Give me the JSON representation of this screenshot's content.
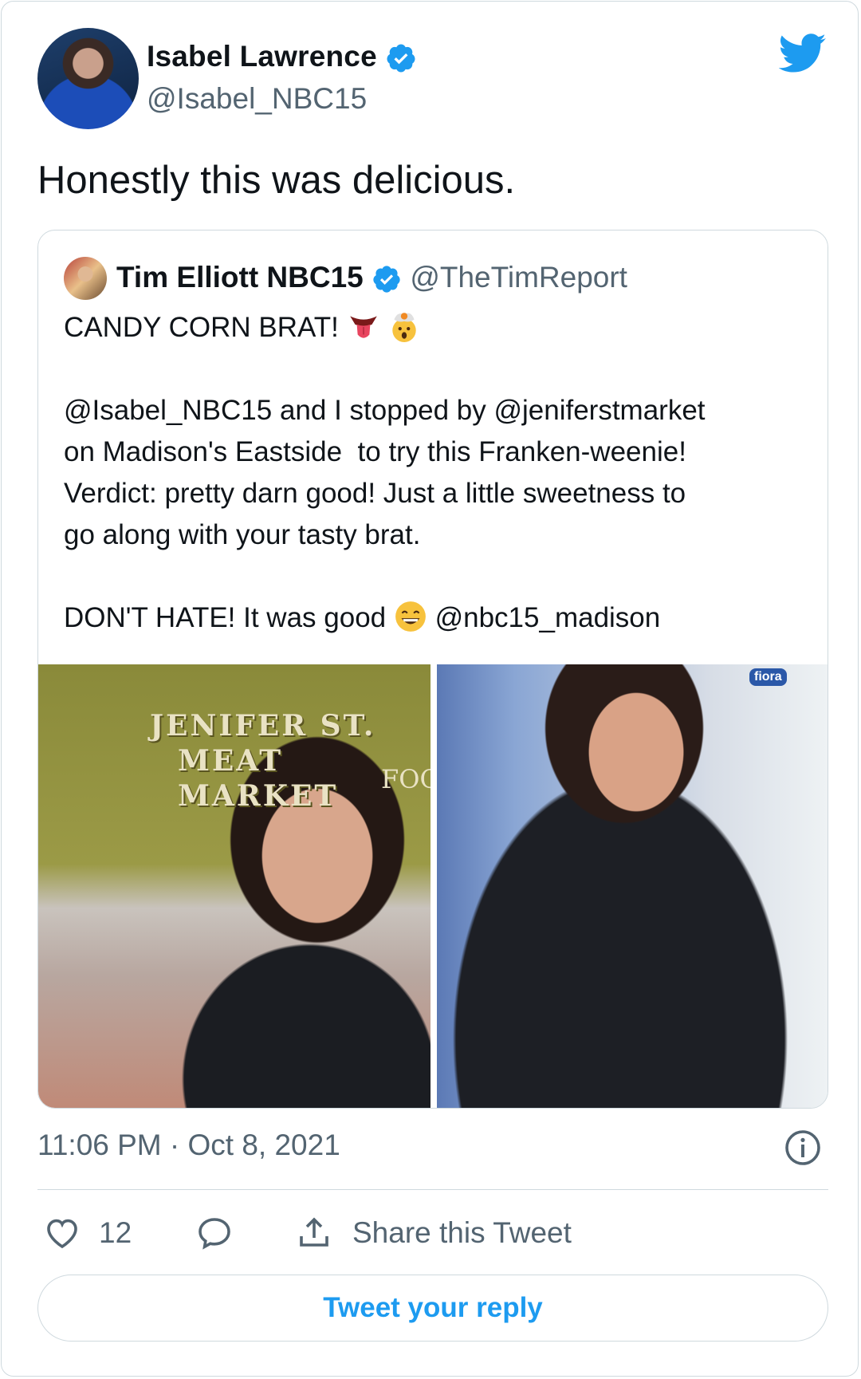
{
  "author": {
    "name": "Isabel Lawrence",
    "handle": "@Isabel_NBC15",
    "verified": true
  },
  "tweet": {
    "text": "Honestly this was delicious."
  },
  "quoted_tweet": {
    "author_name": "Tim Elliott NBC15",
    "author_handle": "@TheTimReport",
    "verified": true,
    "line1": "CANDY CORN BRAT!",
    "paragraph2": "@Isabel_NBC15 and I stopped by @jeniferstmarket\non Madison's Eastside  to try this Franken-weenie!\nVerdict: pretty darn good! Just a little sweetness to\ngo along with your tasty brat.",
    "line3_prefix": "DON'T HATE! It was good",
    "line3_suffix": "@nbc15_madison",
    "photo_sign_line1": "JENIFER ST.",
    "photo_sign_line2": "MEAT MARKET",
    "photo_sign_line3": "FOO",
    "photo_store_logo": "fiora"
  },
  "meta": {
    "timestamp": "11:06 PM · Oct 8, 2021"
  },
  "actions": {
    "like_count": "12",
    "share_label": "Share this Tweet",
    "reply_label": "Tweet your reply"
  },
  "colors": {
    "accent": "#1d9bf0",
    "secondary_text": "#536471",
    "border": "#cfd9de"
  },
  "icons": [
    "verified-badge-icon",
    "twitter-bird-icon",
    "info-icon",
    "heart-icon",
    "comment-icon",
    "share-icon",
    "tongue-emoji-icon",
    "mind-blown-emoji-icon",
    "grin-emoji-icon"
  ]
}
